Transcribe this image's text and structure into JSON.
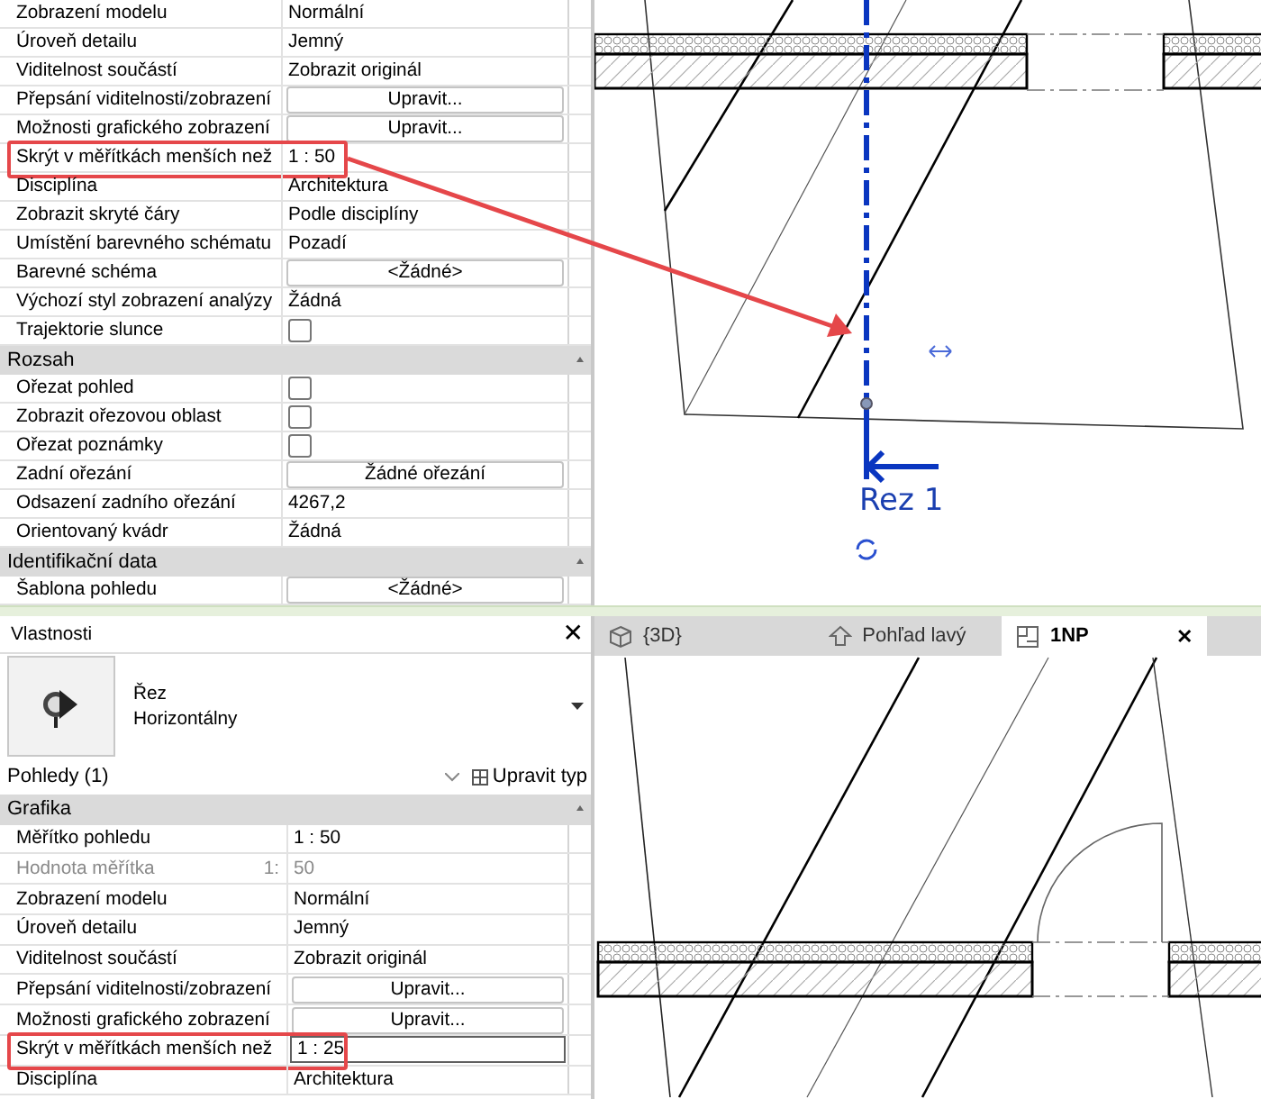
{
  "top_view": {
    "properties": {
      "rows": [
        {
          "kind": "text",
          "label": "Zobrazení modelu",
          "value": "Normální",
          "disabled": false,
          "highlighted": false
        },
        {
          "kind": "text",
          "label": "Úroveň detailu",
          "value": "Jemný",
          "disabled": false,
          "highlighted": false
        },
        {
          "kind": "text",
          "label": "Viditelnost součástí",
          "value": "Zobrazit originál",
          "disabled": false,
          "highlighted": false
        },
        {
          "kind": "button",
          "label": "Přepsání viditelnosti/zobrazení",
          "value": "Upravit...",
          "disabled": false,
          "highlighted": false
        },
        {
          "kind": "button",
          "label": "Možnosti grafického zobrazení",
          "value": "Upravit...",
          "disabled": false,
          "highlighted": false
        },
        {
          "kind": "text",
          "label": "Skrýt v měřítkách menších než",
          "value": "1 : 50",
          "disabled": false,
          "highlighted": true
        },
        {
          "kind": "text",
          "label": "Disciplína",
          "value": "Architektura",
          "disabled": false,
          "highlighted": false
        },
        {
          "kind": "text",
          "label": "Zobrazit skryté čáry",
          "value": "Podle disciplíny",
          "disabled": false,
          "highlighted": false
        },
        {
          "kind": "text",
          "label": "Umístění barevného schématu",
          "value": "Pozadí",
          "disabled": false,
          "highlighted": false
        },
        {
          "kind": "button",
          "label": "Barevné schéma",
          "value": "<Žádné>",
          "disabled": false,
          "highlighted": false
        },
        {
          "kind": "text",
          "label": "Výchozí styl zobrazení analýzy",
          "value": "Žádná",
          "disabled": false,
          "highlighted": false
        },
        {
          "kind": "checkbox",
          "label": "Trajektorie slunce",
          "checked": false,
          "disabled": false,
          "highlighted": false
        },
        {
          "kind": "header",
          "label": "Rozsah"
        },
        {
          "kind": "checkbox",
          "label": "Ořezat pohled",
          "checked": false,
          "disabled": false,
          "highlighted": false
        },
        {
          "kind": "checkbox",
          "label": "Zobrazit ořezovou oblast",
          "checked": false,
          "disabled": false,
          "highlighted": false
        },
        {
          "kind": "checkbox",
          "label": "Ořezat poznámky",
          "checked": false,
          "disabled": false,
          "highlighted": false
        },
        {
          "kind": "button",
          "label": "Zadní ořezání",
          "value": "Žádné ořezání",
          "disabled": false,
          "highlighted": false
        },
        {
          "kind": "text",
          "label": "Odsazení zadního ořezání",
          "value": "4267,2",
          "disabled": false,
          "highlighted": false
        },
        {
          "kind": "text",
          "label": "Orientovaný kvádr",
          "value": "Žádná",
          "disabled": false,
          "highlighted": false
        },
        {
          "kind": "header",
          "label": "Identifikační data"
        },
        {
          "kind": "button",
          "label": "Šablona pohledu",
          "value": "<Žádné>",
          "disabled": false,
          "highlighted": false
        }
      ]
    },
    "drawing": {
      "section_label": "Rez 1"
    }
  },
  "bottom_view": {
    "properties": {
      "title": "Vlastnosti",
      "close": "✕",
      "type_name": "Řez",
      "type_subname": "Horizontálny",
      "filter": "Pohledy (1)",
      "edit_type": "Upravit typ",
      "rows": [
        {
          "kind": "header",
          "label": "Grafika"
        },
        {
          "kind": "text",
          "label": "Měřítko pohledu",
          "value": "1 : 50",
          "disabled": false,
          "highlighted": false
        },
        {
          "kind": "text",
          "label": "Hodnota měřítka",
          "suffix": "1:",
          "value": "50",
          "disabled": true,
          "highlighted": false
        },
        {
          "kind": "text",
          "label": "Zobrazení modelu",
          "value": "Normální",
          "disabled": false,
          "highlighted": false
        },
        {
          "kind": "text",
          "label": "Úroveň detailu",
          "value": "Jemný",
          "disabled": false,
          "highlighted": false
        },
        {
          "kind": "text",
          "label": "Viditelnost součástí",
          "value": "Zobrazit originál",
          "disabled": false,
          "highlighted": false
        },
        {
          "kind": "button",
          "label": "Přepsání viditelnosti/zobrazení",
          "value": "Upravit...",
          "disabled": false,
          "highlighted": false
        },
        {
          "kind": "button",
          "label": "Možnosti grafického zobrazení",
          "value": "Upravit...",
          "disabled": false,
          "highlighted": false
        },
        {
          "kind": "input",
          "label": "Skrýt v měřítkách menších než",
          "value": "1 : 25",
          "disabled": false,
          "highlighted": true
        },
        {
          "kind": "text",
          "label": "Disciplína",
          "value": "Architektura",
          "disabled": false,
          "highlighted": false
        }
      ]
    },
    "tabs": [
      {
        "kind": "model",
        "label": "{3D}",
        "selected": false
      },
      {
        "kind": "elevation",
        "label": "Pohľad lavý",
        "selected": false
      },
      {
        "kind": "plan",
        "label": "1NP",
        "selected": true,
        "close": "✕"
      }
    ]
  }
}
